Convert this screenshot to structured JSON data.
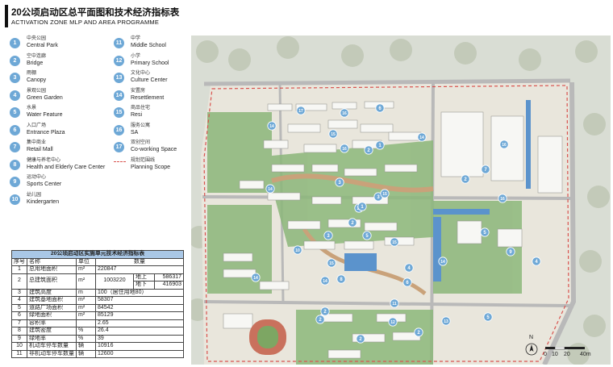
{
  "header": {
    "title": "20公顷启动区总平面图和技术经济指标表",
    "subtitle": "ACTIVATION ZONE MLP AND AREA PROGRAMME"
  },
  "legend": {
    "items": [
      {
        "num": "1",
        "cn": "中央公园",
        "en": "Central Park"
      },
      {
        "num": "2",
        "cn": "空中连廊",
        "en": "Bridge"
      },
      {
        "num": "3",
        "cn": "雨棚",
        "en": "Canopy"
      },
      {
        "num": "4",
        "cn": "景观公园",
        "en": "Green Garden"
      },
      {
        "num": "5",
        "cn": "水景",
        "en": "Water Feature"
      },
      {
        "num": "6",
        "cn": "入口广场",
        "en": "Entrance Plaza"
      },
      {
        "num": "7",
        "cn": "集中商业",
        "en": "Retail Mall"
      },
      {
        "num": "8",
        "cn": "健康与养老中心",
        "en": "Health and Elderly Care Center"
      },
      {
        "num": "9",
        "cn": "运动中心",
        "en": "Sports Center"
      },
      {
        "num": "10",
        "cn": "幼儿园",
        "en": "Kindergarten"
      },
      {
        "num": "11",
        "cn": "中学",
        "en": "Middle School"
      },
      {
        "num": "12",
        "cn": "小学",
        "en": "Primary School"
      },
      {
        "num": "13",
        "cn": "文化中心",
        "en": "Culture Center"
      },
      {
        "num": "14",
        "cn": "安置房",
        "en": "Resettlement"
      },
      {
        "num": "15",
        "cn": "商品住宅",
        "en": "Resi"
      },
      {
        "num": "16",
        "cn": "服务公寓",
        "en": "SA"
      },
      {
        "num": "17",
        "cn": "双创空间",
        "en": "Co-working Space"
      }
    ],
    "scope": {
      "cn": "规划范围线",
      "en": "Planning Scope"
    }
  },
  "table": {
    "caption": "20公顷启动区实施单元技术经济指标表",
    "headers": {
      "no": "序号",
      "name": "名称",
      "unit": "单位",
      "qty": "数量"
    },
    "rows": [
      {
        "no": "1",
        "name": "总用地面积",
        "unit": "m²",
        "value": "220847"
      },
      {
        "no": "2",
        "name": "总建筑面积",
        "unit": "m²",
        "value": "1003220",
        "sub": [
          {
            "label": "地上",
            "value": "586317"
          },
          {
            "label": "地下",
            "value": "416903"
          }
        ]
      },
      {
        "no": "3",
        "name": "建筑高度",
        "unit": "m",
        "value": "100（居住用地80）"
      },
      {
        "no": "4",
        "name": "建筑基地面积",
        "unit": "m²",
        "value": "58307"
      },
      {
        "no": "5",
        "name": "道路广场面积",
        "unit": "m²",
        "value": "84542"
      },
      {
        "no": "6",
        "name": "绿地面积",
        "unit": "m²",
        "value": "85129"
      },
      {
        "no": "7",
        "name": "容积率",
        "unit": "",
        "value": "2.65"
      },
      {
        "no": "8",
        "name": "建筑密度",
        "unit": "%",
        "value": "26.4"
      },
      {
        "no": "9",
        "name": "绿地率",
        "unit": "%",
        "value": "39"
      },
      {
        "no": "10",
        "name": "机动车停车数量",
        "unit": "辆",
        "value": "10916"
      },
      {
        "no": "11",
        "name": "非机动车停车数量",
        "unit": "辆",
        "value": "12600"
      }
    ]
  },
  "map": {
    "markers": [
      "17",
      "16",
      "6",
      "16",
      "14",
      "15",
      "2",
      "14",
      "1",
      "7",
      "16",
      "2",
      "3",
      "3",
      "15",
      "16",
      "13",
      "14",
      "1",
      "5",
      "2",
      "5",
      "9",
      "3",
      "4",
      "15",
      "10",
      "14",
      "15",
      "4",
      "14",
      "14",
      "6",
      "8",
      "2",
      "11",
      "12",
      "5",
      "13",
      "2",
      "2",
      "2"
    ],
    "scale": {
      "labels": [
        "0",
        "10",
        "20",
        "40m"
      ]
    },
    "north_label": "N",
    "colors": {
      "marker": "#6ea8d6",
      "green": "#8cb77a",
      "road": "#b9b9b9",
      "water": "#5b93cc",
      "scope": "#d9534f"
    }
  }
}
